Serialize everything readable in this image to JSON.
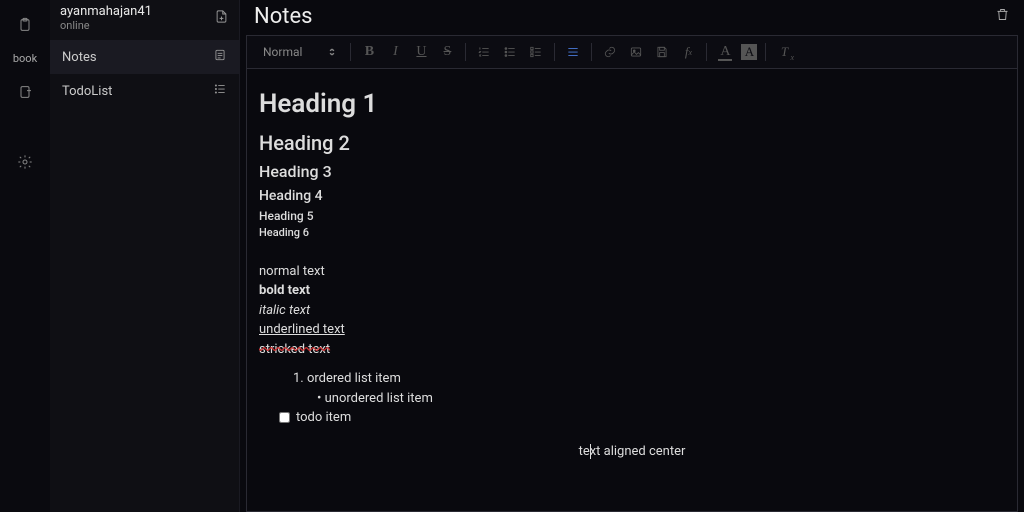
{
  "rail": {
    "book_label": "book"
  },
  "sidebar": {
    "user_name": "ayanmahajan41",
    "user_status": "online",
    "items": [
      {
        "label": "Notes",
        "active": true,
        "icon": "doc"
      },
      {
        "label": "TodoList",
        "active": false,
        "icon": "list"
      }
    ]
  },
  "main": {
    "title": "Notes"
  },
  "toolbar": {
    "style_label": "Normal"
  },
  "content": {
    "h1": "Heading 1",
    "h2": "Heading 2",
    "h3": "Heading 3",
    "h4": "Heading 4",
    "h5": "Heading 5",
    "h6": "Heading 6",
    "normal": "normal text",
    "bold": "bold text",
    "italic": "italic text",
    "under": "underlined text",
    "strike": "stricked text",
    "ol_item": "ordered list item",
    "ul_item": "unordered list item",
    "todo_item": "todo item",
    "center": "text aligned center"
  }
}
